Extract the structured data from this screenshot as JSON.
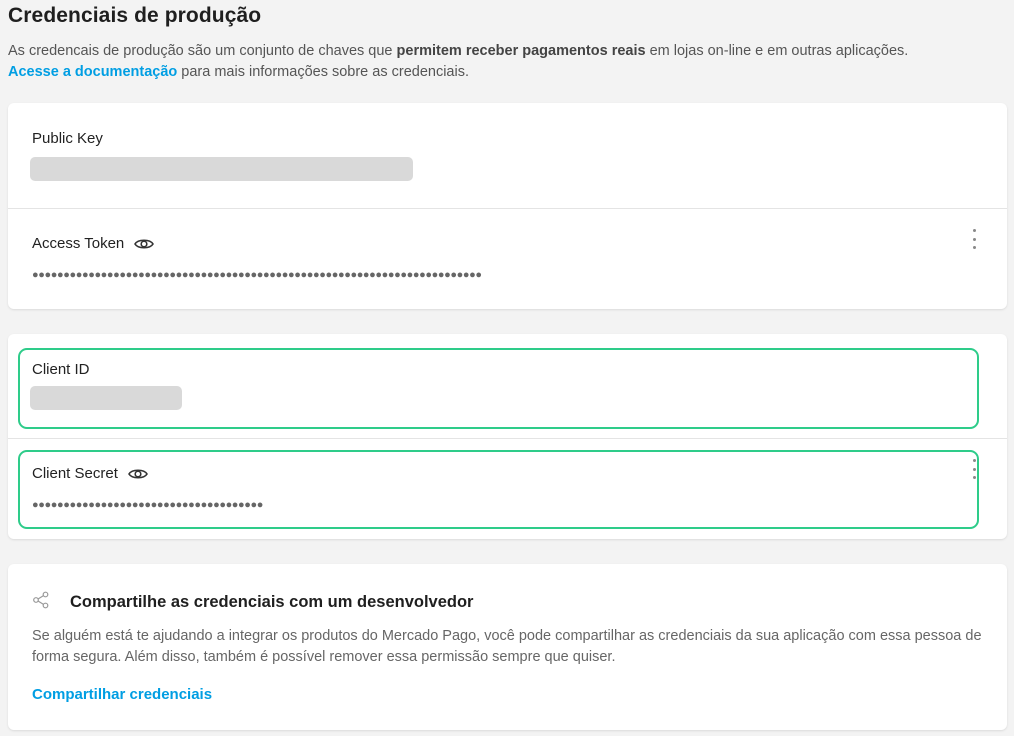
{
  "page": {
    "title": "Credenciais de produção",
    "intro_part1": "As credencais de produção são um conjunto de chaves que ",
    "intro_bold": "permitem receber pagamentos reais",
    "intro_part2": " em lojas on-line e em outras aplicações.",
    "doc_link": "Acesse a documentação",
    "intro_part3": " para mais informações sobre as credenciais."
  },
  "production_card": {
    "public_key_label": "Public Key",
    "access_token_label": "Access Token",
    "access_token_masked": "●●●●●●●●●●●●●●●●●●●●●●●●●●●●●●●●●●●●●●●●●●●●●●●●●●●●●●●●●●●●●●●●●●●●●●●●"
  },
  "client_card": {
    "client_id_label": "Client ID",
    "client_secret_label": "Client Secret",
    "client_secret_masked": "●●●●●●●●●●●●●●●●●●●●●●●●●●●●●●●●●●●●●"
  },
  "share_card": {
    "title": "Compartilhe as credenciais com um desenvolvedor",
    "description": "Se alguém está te ajudando a integrar os produtos do Mercado Pago, você pode compartilhar as credenciais da sua aplicação com essa pessoa de forma segura. Além disso, também é possível remover essa permissão sempre que quiser.",
    "link": "Compartilhar credenciais"
  },
  "colors": {
    "link": "#009ee3",
    "highlight": "#2ecc8a",
    "background": "#f3f3f3"
  },
  "icons": {
    "eye": "eye-icon",
    "kebab": "kebab-menu-icon",
    "share": "share-icon"
  }
}
